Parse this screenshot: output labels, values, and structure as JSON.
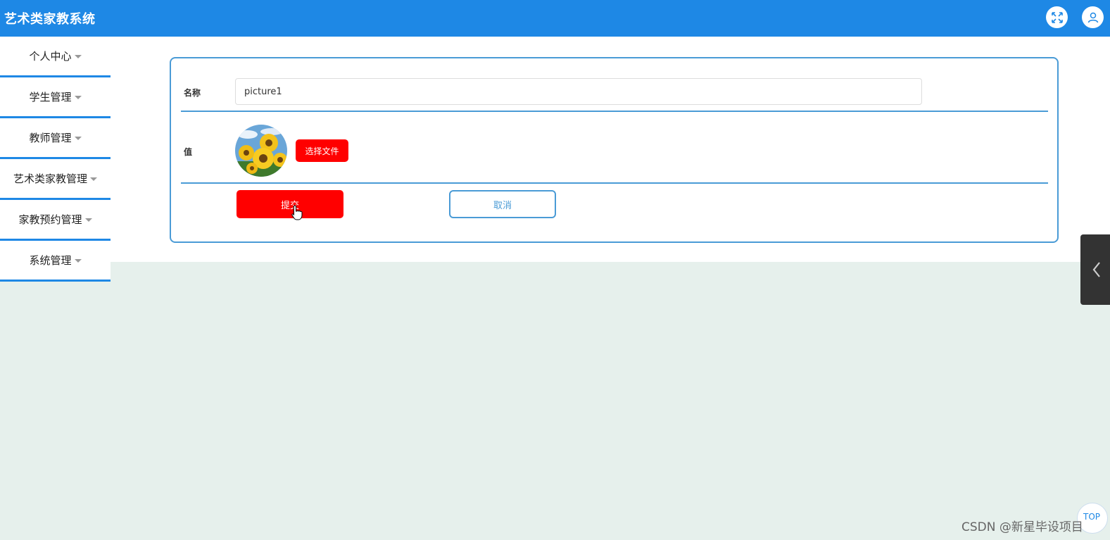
{
  "app": {
    "title": "艺术类家教系统"
  },
  "header": {
    "fullscreen_icon": "expand-icon",
    "user_icon": "user-icon",
    "accent": "#1e88e5"
  },
  "sidebar": {
    "items": [
      {
        "label": "个人中心"
      },
      {
        "label": "学生管理"
      },
      {
        "label": "教师管理"
      },
      {
        "label": "艺术类家教管理"
      },
      {
        "label": "家教预约管理"
      },
      {
        "label": "系统管理"
      }
    ]
  },
  "form": {
    "name_label": "名称",
    "name_value": "picture1",
    "value_label": "值",
    "choose_file_label": "选择文件",
    "submit_label": "提交",
    "cancel_label": "取消",
    "button_color": "#ff0000",
    "border_color": "#4a9bd6"
  },
  "footer": {
    "watermark": "CSDN @新星毕设项目",
    "top_label": "TOP"
  }
}
